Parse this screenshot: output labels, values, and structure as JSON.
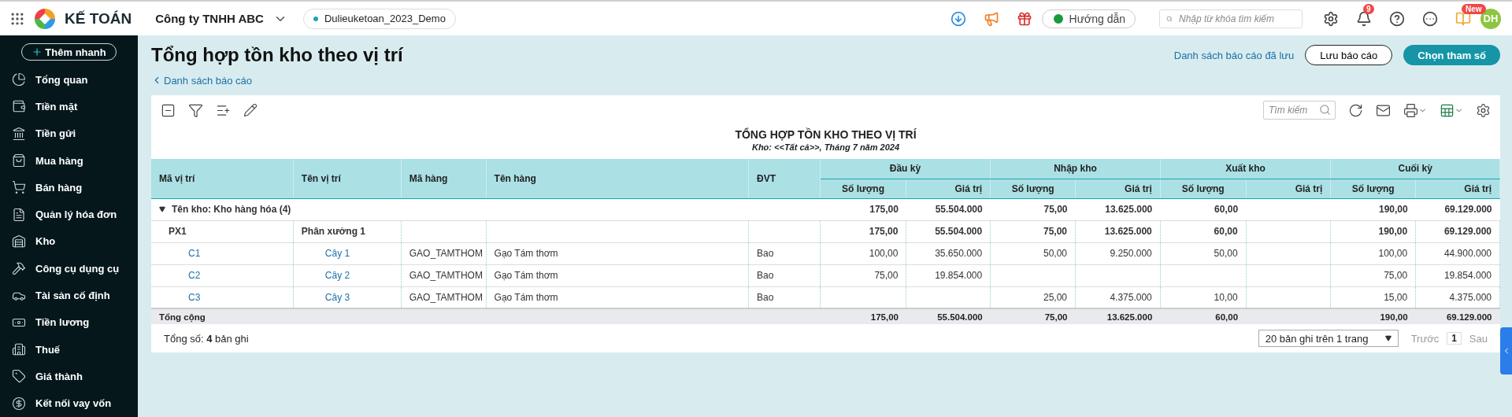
{
  "topbar": {
    "brand": "KẾ TOÁN",
    "company": "Công ty TNHH ABC",
    "database": "Dulieuketoan_2023_Demo",
    "guide_button": "Hướng dẫn",
    "search": {
      "placeholder": "Nhập từ khóa tìm kiếm"
    },
    "notification_count": "9",
    "new_badge": "New",
    "avatar": "DH"
  },
  "sidebar": {
    "quick_add": "Thêm nhanh",
    "items": [
      {
        "label": "Tổng quan"
      },
      {
        "label": "Tiền mặt"
      },
      {
        "label": "Tiền gửi"
      },
      {
        "label": "Mua hàng"
      },
      {
        "label": "Bán hàng"
      },
      {
        "label": "Quản lý hóa đơn"
      },
      {
        "label": "Kho"
      },
      {
        "label": "Công cụ dụng cụ"
      },
      {
        "label": "Tài sản cố định"
      },
      {
        "label": "Tiền lương"
      },
      {
        "label": "Thuế"
      },
      {
        "label": "Giá thành"
      },
      {
        "label": "Kết nối vay vốn"
      }
    ]
  },
  "page": {
    "title": "Tổng hợp tồn kho theo vị trí",
    "back_link": "Danh sách báo cáo",
    "saved_reports_link": "Danh sách báo cáo đã lưu",
    "save_button": "Lưu báo cáo",
    "params_button": "Chọn tham số"
  },
  "toolbar": {
    "search": {
      "placeholder": "Tìm kiếm"
    }
  },
  "report": {
    "title": "TỔNG HỢP TỒN KHO THEO VỊ TRÍ",
    "subtitle": "Kho: <<Tất cả>>, Tháng 7 năm 2024"
  },
  "table": {
    "columns": [
      {
        "label": "Mã vị trí"
      },
      {
        "label": "Tên vị trí"
      },
      {
        "label": "Mã hàng"
      },
      {
        "label": "Tên hàng"
      },
      {
        "label": "ĐVT"
      }
    ],
    "column_groups": [
      {
        "label": "Đầu kỳ",
        "sub": [
          "Số lượng",
          "Giá trị"
        ]
      },
      {
        "label": "Nhập kho",
        "sub": [
          "Số lượng",
          "Giá trị"
        ]
      },
      {
        "label": "Xuất kho",
        "sub": [
          "Số lượng",
          "Giá trị"
        ]
      },
      {
        "label": "Cuối kỳ",
        "sub": [
          "Số lượng",
          "Giá trị"
        ]
      }
    ],
    "rows": [
      {
        "kind": "group",
        "label": "Tên kho: Kho hàng hóa (4)",
        "expanded": true,
        "values": {
          "opening_qty": "175,00",
          "opening_value": "55.504.000",
          "in_qty": "75,00",
          "in_value": "13.625.000",
          "out_qty": "60,00",
          "closing_qty": "190,00",
          "closing_value": "69.129.000"
        }
      },
      {
        "kind": "location",
        "cells": {
          "location_code": "PX1",
          "location_name": "Phân xưởng 1",
          "opening_qty": "175,00",
          "opening_value": "55.504.000",
          "in_qty": "75,00",
          "in_value": "13.625.000",
          "out_qty": "60,00",
          "closing_qty": "190,00",
          "closing_value": "69.129.000"
        }
      },
      {
        "kind": "item",
        "cells": {
          "location_code": "C1",
          "location_name": "Cây 1",
          "item_code": "GAO_TAMTHOM",
          "item_name": "Gạo Tám thơm",
          "unit": "Bao",
          "opening_qty": "100,00",
          "opening_value": "35.650.000",
          "in_qty": "50,00",
          "in_value": "9.250.000",
          "out_qty": "50,00",
          "closing_qty": "100,00",
          "closing_value": "44.900.000"
        }
      },
      {
        "kind": "item",
        "cells": {
          "location_code": "C2",
          "location_name": "Cây 2",
          "item_code": "GAO_TAMTHOM",
          "item_name": "Gạo Tám thơm",
          "unit": "Bao",
          "opening_qty": "75,00",
          "opening_value": "19.854.000",
          "closing_qty": "75,00",
          "closing_value": "19.854.000"
        }
      },
      {
        "kind": "item",
        "cells": {
          "location_code": "C3",
          "location_name": "Cây 3",
          "item_code": "GAO_TAMTHOM",
          "item_name": "Gạo Tám thơm",
          "unit": "Bao",
          "in_qty": "25,00",
          "in_value": "4.375.000",
          "out_qty": "10,00",
          "closing_qty": "15,00",
          "closing_value": "4.375.000"
        }
      },
      {
        "kind": "total",
        "label": "Tổng cộng",
        "values": {
          "opening_qty": "175,00",
          "opening_value": "55.504.000",
          "in_qty": "75,00",
          "in_value": "13.625.000",
          "out_qty": "60,00",
          "closing_qty": "190,00",
          "closing_value": "69.129.000"
        }
      }
    ]
  },
  "footer": {
    "record_count": "Tổng số: **4** bản ghi",
    "page_size": "20 bản ghi trên 1 trang",
    "prev": "Trước",
    "page": "1",
    "next": "Sau",
    "prev_disabled": true,
    "next_disabled": true
  }
}
